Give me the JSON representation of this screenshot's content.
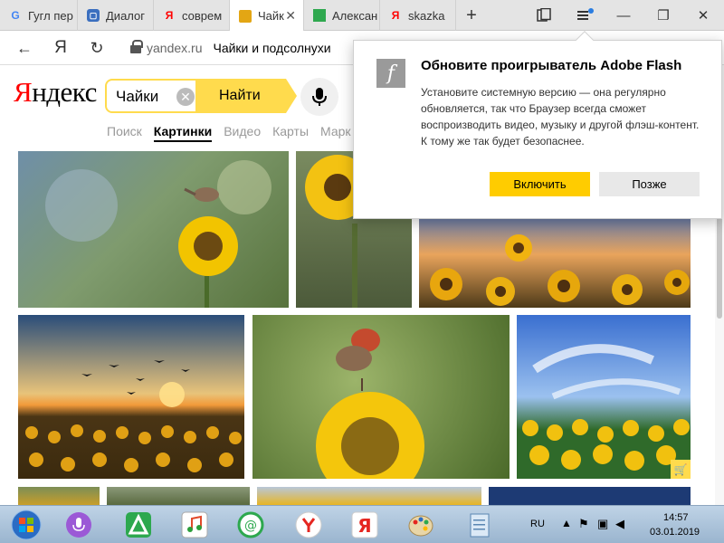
{
  "tabs": [
    {
      "title": "Гугл пер",
      "favicon": "google-icon",
      "active": false
    },
    {
      "title": "Диалог",
      "favicon": "chat-icon",
      "active": false
    },
    {
      "title": "соврем",
      "favicon": "yandex-icon",
      "active": false
    },
    {
      "title": "Чайк",
      "favicon": "sunflower-icon",
      "active": true
    },
    {
      "title": "Алексан",
      "favicon": "green-square-icon",
      "active": false
    },
    {
      "title": "skazka",
      "favicon": "yandex-icon",
      "active": false
    }
  ],
  "new_tab": "+",
  "address": {
    "domain": "yandex.ru",
    "title": "Чайки и подсолнухи"
  },
  "logo": {
    "first": "Я",
    "rest": "ндекс"
  },
  "search": {
    "query": "Чайки",
    "button": "Найти"
  },
  "services": [
    {
      "label": "Поиск",
      "active": false
    },
    {
      "label": "Картинки",
      "active": true
    },
    {
      "label": "Видео",
      "active": false
    },
    {
      "label": "Карты",
      "active": false
    },
    {
      "label": "Марк",
      "active": false
    }
  ],
  "flash_popup": {
    "title": "Обновите проигрыватель Adobe Flash",
    "body": "Установите системную версию — она регулярно обновляется, так что Браузер всегда сможет воспроизводить видео, музыку и другой флэш-контент. К тому же так будет безопаснее.",
    "enable": "Включить",
    "later": "Позже"
  },
  "taskbar": {
    "lang": "RU",
    "time": "14:57",
    "date": "03.01.2019"
  },
  "colors": {
    "yandex_red": "#ff0000",
    "search_yellow": "#ffdb4d",
    "enable_yellow": "#ffcc00"
  }
}
